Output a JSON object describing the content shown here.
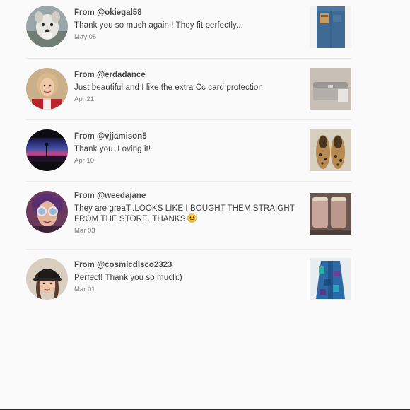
{
  "messages": [
    {
      "from": "From @okiegal58",
      "text": "Thank you so much again!! They fit perfectly...",
      "date": "May 05",
      "avatar_icon": "dog-avatar",
      "item_icon": "jeans-thumbnail"
    },
    {
      "from": "From @erdadance",
      "text": "Just beautiful and I like the extra Cc card protection",
      "date": "Apr 21",
      "avatar_icon": "woman-avatar",
      "item_icon": "wallet-thumbnail"
    },
    {
      "from": "From @vjjamison5",
      "text": "Thank you. Loving it!",
      "date": "Apr 10",
      "avatar_icon": "sunset-avatar",
      "item_icon": "leopard-flats-thumbnail"
    },
    {
      "from": "From @weedajane",
      "text": "They are greaT..LOOKS LIKE I BOUGHT THEM STRAIGHT FROM THE STORE. THANKS",
      "emoji": "smiling-face-emoji",
      "date": "Mar 03",
      "avatar_icon": "sunglasses-avatar",
      "item_icon": "boots-thumbnail"
    },
    {
      "from": "From @cosmicdisco2323",
      "text": "Perfect! Thank you so much:)",
      "date": "Mar 01",
      "avatar_icon": "hat-avatar",
      "item_icon": "blue-dress-thumbnail"
    }
  ]
}
